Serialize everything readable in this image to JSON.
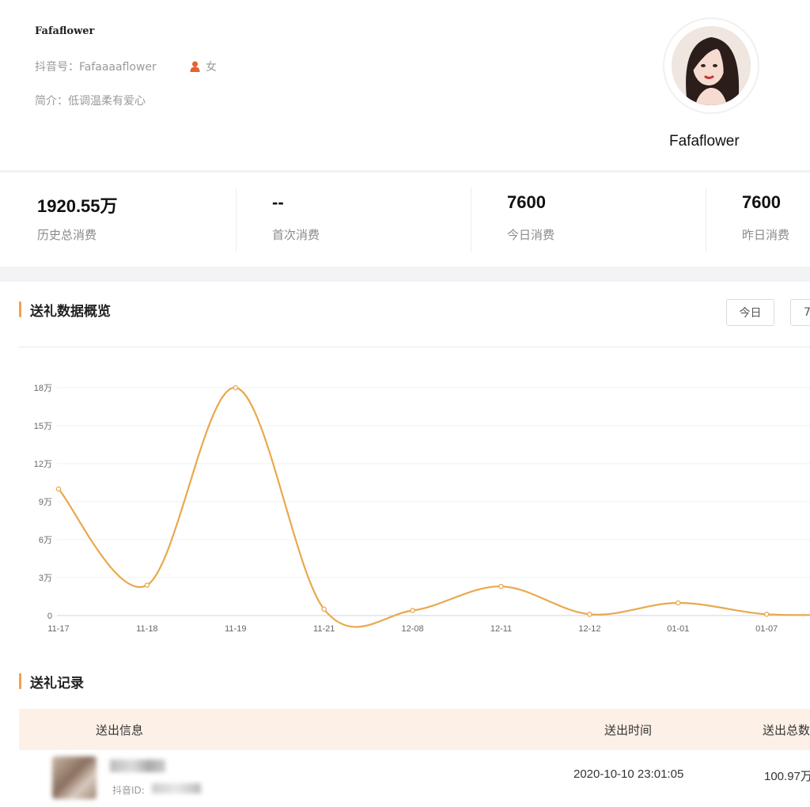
{
  "profile": {
    "username": "Fafaflower",
    "douyin_id": "抖音号：Fafaaaaflower",
    "gender": "女",
    "bio": "简介：低调温柔有爱心",
    "avatar_name": "Fafaflower"
  },
  "stats": [
    {
      "value": "1920.55万",
      "label": "历史总消费"
    },
    {
      "value": "--",
      "label": "首次消费"
    },
    {
      "value": "7600",
      "label": "今日消费"
    },
    {
      "value": "7600",
      "label": "昨日消费"
    }
  ],
  "gift_overview": {
    "title": "送礼数据概览",
    "range_buttons": [
      "今日",
      "7"
    ]
  },
  "chart_data": {
    "type": "line",
    "title": "",
    "xlabel": "",
    "ylabel": "",
    "x": [
      "11-17",
      "11-18",
      "11-19",
      "11-21",
      "12-08",
      "12-11",
      "12-12",
      "01-01",
      "01-07",
      ""
    ],
    "y": [
      10,
      2.4,
      18,
      0.5,
      0.4,
      2.3,
      0.1,
      1,
      0.1,
      0.1
    ],
    "ylim": [
      0,
      18
    ],
    "yticks": [
      0,
      3,
      6,
      9,
      12,
      15,
      18
    ],
    "ytick_labels": [
      "0",
      "3万",
      "6万",
      "9万",
      "12万",
      "15万",
      "18万"
    ],
    "grid": true,
    "color": "#e9a84d"
  },
  "records": {
    "title": "送礼记录",
    "headers": {
      "info": "送出信息",
      "time": "送出时间",
      "total": "送出总数"
    },
    "rows": [
      {
        "id_label": "抖音ID:",
        "time": "2020-10-10 23:01:05",
        "total": "100.97万"
      }
    ]
  }
}
